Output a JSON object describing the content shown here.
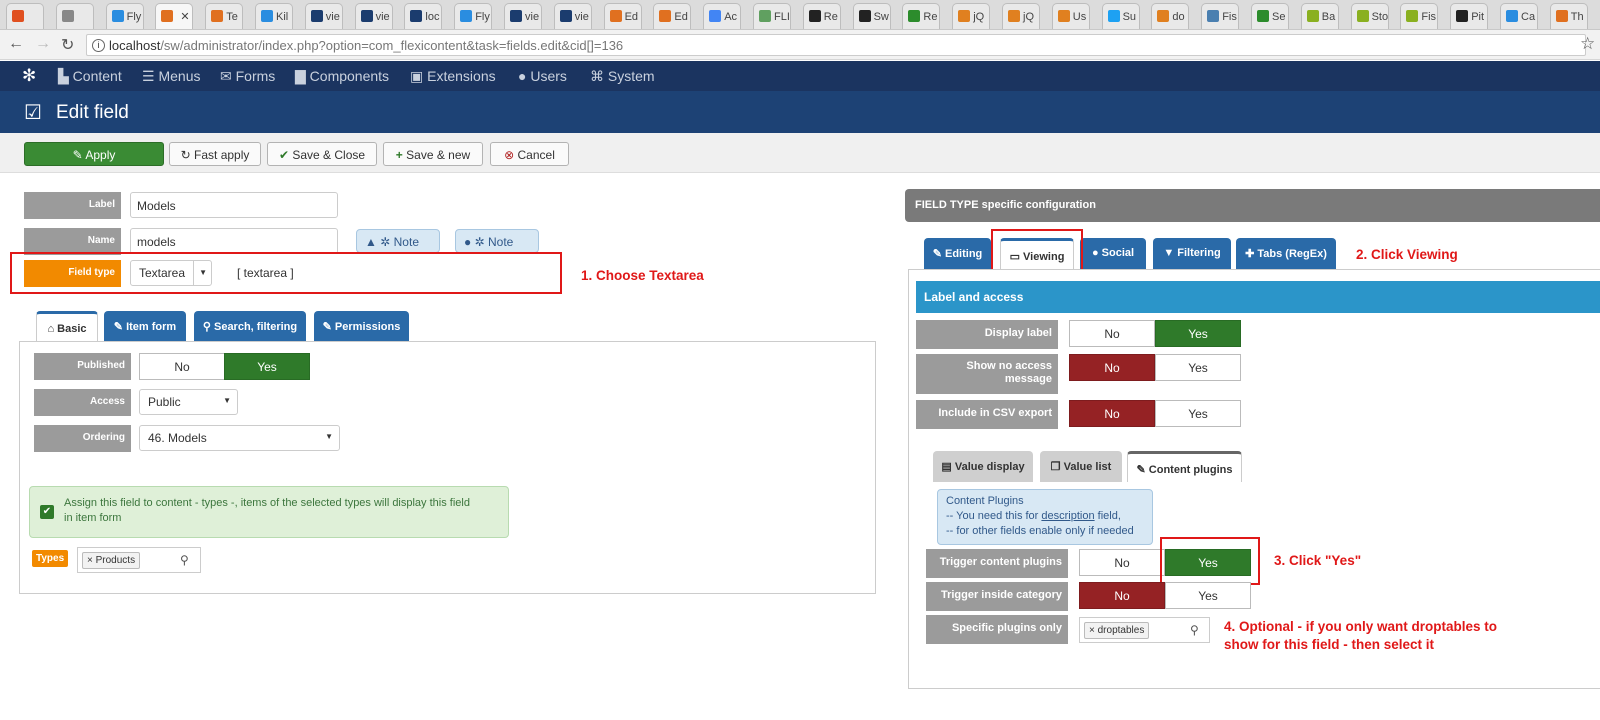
{
  "browser": {
    "tabs": [
      {
        "label": "",
        "color": "#e05020"
      },
      {
        "label": "",
        "color": "#888888"
      },
      {
        "label": "Fly",
        "color": "#2a8de0"
      },
      {
        "label": "",
        "color": "#e07020",
        "active": true
      },
      {
        "label": "Te",
        "color": "#e07020"
      },
      {
        "label": "Kil",
        "color": "#2a8de0"
      },
      {
        "label": "vie",
        "color": "#1b3c6e"
      },
      {
        "label": "vie",
        "color": "#1b3c6e"
      },
      {
        "label": "loc",
        "color": "#1b3c6e"
      },
      {
        "label": "Fly",
        "color": "#2a8de0"
      },
      {
        "label": "vie",
        "color": "#1b3c6e"
      },
      {
        "label": "vie",
        "color": "#1b3c6e"
      },
      {
        "label": "Ed",
        "color": "#e07020"
      },
      {
        "label": "Ed",
        "color": "#e07020"
      },
      {
        "label": "Ac",
        "color": "#4285f4"
      },
      {
        "label": "FLI",
        "color": "#60a060"
      },
      {
        "label": "Re",
        "color": "#222222"
      },
      {
        "label": "Sw",
        "color": "#222222"
      },
      {
        "label": "Re",
        "color": "#2c8c2c"
      },
      {
        "label": "jQ",
        "color": "#e08020"
      },
      {
        "label": "jQ",
        "color": "#e08020"
      },
      {
        "label": "Us",
        "color": "#e08020"
      },
      {
        "label": "Su",
        "color": "#1da1f2"
      },
      {
        "label": "do",
        "color": "#e08020"
      },
      {
        "label": "Fis",
        "color": "#4a7fb0"
      },
      {
        "label": "Se",
        "color": "#2c8c2c"
      },
      {
        "label": "Ba",
        "color": "#8ab020"
      },
      {
        "label": "Sto",
        "color": "#8ab020"
      },
      {
        "label": "Fis",
        "color": "#8ab020"
      },
      {
        "label": "Pit",
        "color": "#222222"
      },
      {
        "label": "Ca",
        "color": "#2a8de0"
      },
      {
        "label": "Th",
        "color": "#e07020"
      }
    ],
    "url_host": "localhost",
    "url_path": "/sw/administrator/index.php?option=com_flexicontent&task=fields.edit&cid[]=136"
  },
  "menu": {
    "items": [
      "Content",
      "Menus",
      "Forms",
      "Components",
      "Extensions",
      "Users",
      "System"
    ]
  },
  "header": {
    "title": "Edit field"
  },
  "toolbar": {
    "apply": "Apply",
    "fast_apply": "Fast apply",
    "save_close": "Save & Close",
    "save_new": "Save & new",
    "cancel": "Cancel"
  },
  "form": {
    "label_label": "Label",
    "label_value": "Models",
    "name_label": "Name",
    "name_value": "models",
    "note1": "Note",
    "note2": "Note",
    "fieldtype_label": "Field type",
    "fieldtype_value": "Textarea",
    "fieldtype_hint": "[ textarea ]"
  },
  "annotations": {
    "a1": "1. Choose Textarea",
    "a2": "2. Click Viewing",
    "a3": "3. Click \"Yes\"",
    "a4_line1": "4. Optional - if you only want droptables to",
    "a4_line2": "show for this field - then select it"
  },
  "left_tabs": [
    "Basic",
    "Item form",
    "Search, filtering",
    "Permissions"
  ],
  "basic": {
    "published_label": "Published",
    "no": "No",
    "yes": "Yes",
    "access_label": "Access",
    "access_value": "Public",
    "ordering_label": "Ordering",
    "ordering_value": "46. Models",
    "assign_line1": "Assign this field to content - types -, items of the selected types will display this field",
    "assign_line2": "in item form",
    "types_label": "Types",
    "types_tag": "Products"
  },
  "right": {
    "panel_title": "FIELD TYPE specific configuration",
    "tabs": [
      "Editing",
      "Viewing",
      "Social",
      "Filtering",
      "Tabs (RegEx)"
    ],
    "section_title": "Label and access",
    "display_label": "Display label",
    "show_no_access_1": "Show no access",
    "show_no_access_2": "message",
    "include_csv": "Include in CSV export",
    "no": "No",
    "yes": "Yes",
    "subtabs": [
      "Value display",
      "Value list",
      "Content plugins"
    ],
    "info_title": "Content Plugins",
    "info_line1_a": "-- You need this for ",
    "info_line1_link": "description",
    "info_line1_b": " field,",
    "info_line2": "-- for other fields enable only if needed",
    "trigger_content": "Trigger content plugins",
    "trigger_category": "Trigger inside category",
    "specific_plugins": "Specific plugins only",
    "plugin_tag": "droptables"
  }
}
